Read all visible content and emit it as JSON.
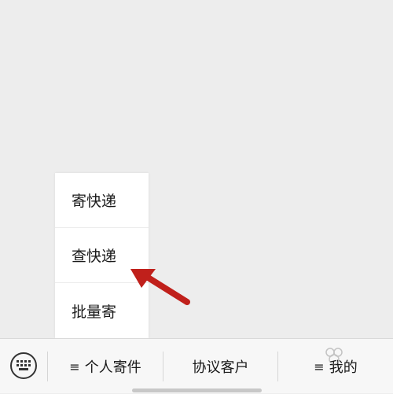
{
  "popup_menu": {
    "items": [
      {
        "label": "寄快递"
      },
      {
        "label": "查快递"
      },
      {
        "label": "批量寄"
      }
    ]
  },
  "bottom_bar": {
    "keyboard_icon": "keyboard-icon",
    "tabs": [
      {
        "label": "个人寄件",
        "menu_glyph": "≡"
      },
      {
        "label": "协议客户"
      },
      {
        "label": "我的",
        "menu_glyph": "≡"
      }
    ]
  },
  "annotation": {
    "arrow_color": "#c0201b"
  }
}
